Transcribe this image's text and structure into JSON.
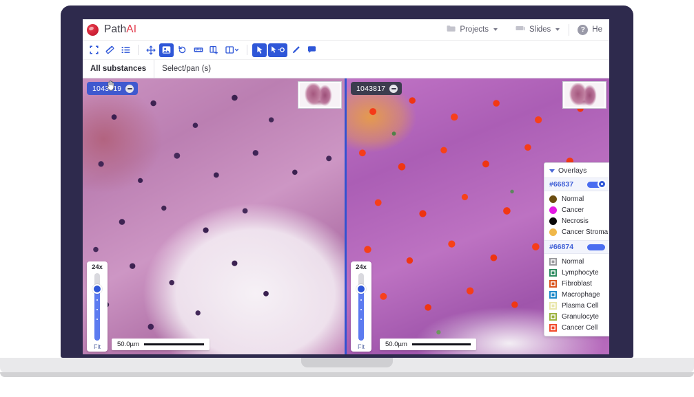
{
  "app": {
    "brand_name": "Path",
    "brand_accent": "AI",
    "brand_accent_color": "#e2394b"
  },
  "topnav": {
    "items": [
      {
        "label": "Projects",
        "icon": "folder-icon"
      },
      {
        "label": "Slides",
        "icon": "slides-icon"
      }
    ],
    "help": {
      "label": "He",
      "icon": "help-circle-icon",
      "glyph": "?"
    }
  },
  "toolbar": {
    "buttons": [
      {
        "name": "fullscreen-button",
        "icon": "expand-icon",
        "active": false
      },
      {
        "name": "measure-button",
        "icon": "ruler-icon",
        "active": false
      },
      {
        "name": "list-button",
        "icon": "list-icon",
        "active": false
      },
      {
        "name": "pan-button",
        "icon": "move-arrows-icon",
        "active": false
      },
      {
        "name": "sync-views-button",
        "icon": "image-sync-icon",
        "active": true
      },
      {
        "name": "reset-rotation-button",
        "icon": "undo-icon",
        "active": false
      },
      {
        "name": "keyboard-shortcuts-button",
        "icon": "keyboard-icon",
        "active": false
      },
      {
        "name": "add-slide-button",
        "icon": "book-add-icon",
        "active": false
      },
      {
        "name": "layout-button",
        "icon": "split-columns-icon",
        "active": false,
        "caret": true
      },
      {
        "name": "select-pointer-button",
        "icon": "cursor-arrow-icon",
        "active": true
      },
      {
        "name": "annotate-point-button",
        "icon": "cursor-point-icon",
        "active": true
      },
      {
        "name": "draw-button",
        "icon": "pencil-icon",
        "active": false
      },
      {
        "name": "comment-button",
        "icon": "comment-bubble-icon",
        "active": false
      }
    ]
  },
  "tabs": [
    {
      "label": "All substances",
      "active": true
    },
    {
      "label": "Select/pan (s)",
      "active": false
    }
  ],
  "viewers": [
    {
      "name": "left",
      "slide_id": "1043819",
      "zoom_level": "24x",
      "fit_label": "Fit",
      "scale_label": "50.0µm",
      "has_cursor": true
    },
    {
      "name": "right",
      "slide_id": "1043817",
      "zoom_level": "24x",
      "fit_label": "Fit",
      "scale_label": "50.0µm",
      "has_cursor": false
    }
  ],
  "overlays": {
    "title": "Overlays",
    "groups": [
      {
        "id": "#66837",
        "enabled": true,
        "swatch_shape": "circle",
        "items": [
          {
            "label": "Normal",
            "color": "#6b4d11"
          },
          {
            "label": "Cancer",
            "color": "#e41ae4"
          },
          {
            "label": "Necrosis",
            "color": "#0a0a0a"
          },
          {
            "label": "Cancer Stroma",
            "color": "#f0b84a"
          }
        ]
      },
      {
        "id": "#66874",
        "enabled": true,
        "swatch_shape": "square",
        "items": [
          {
            "label": "Normal",
            "color": "#9a9a9e"
          },
          {
            "label": "Lymphocyte",
            "color": "#2b8b5f"
          },
          {
            "label": "Fibroblast",
            "color": "#d9551e"
          },
          {
            "label": "Macrophage",
            "color": "#1e8ac9"
          },
          {
            "label": "Plasma Cell",
            "color": "#e9e6ab"
          },
          {
            "label": "Granulocyte",
            "color": "#9cb23d"
          },
          {
            "label": "Cancer Cell",
            "color": "#f2492a"
          }
        ]
      }
    ]
  }
}
